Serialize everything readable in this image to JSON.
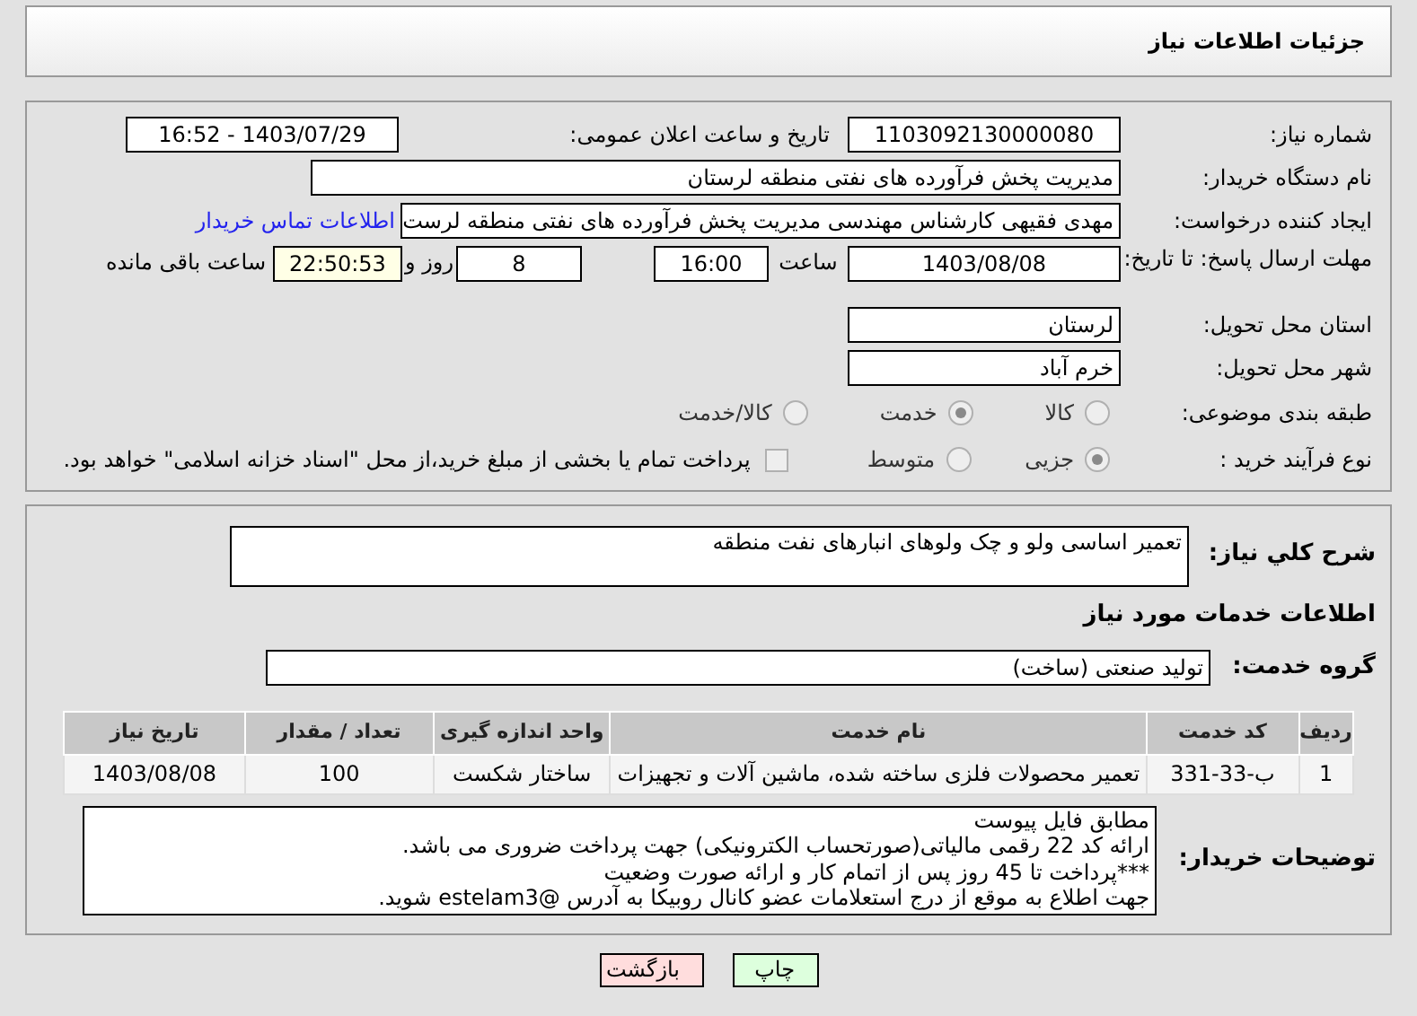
{
  "page_title": "جزئیات اطلاعات نیاز",
  "need_number": {
    "label": "شماره نیاز:",
    "value": "1103092130000080"
  },
  "announce_date": {
    "label": "تاریخ و ساعت اعلان عمومی:",
    "value": "1403/07/29 - 16:52"
  },
  "buyer_org": {
    "label": "نام دستگاه خریدار:",
    "value": "مدیریت پخش فرآورده های نفتی منطقه لرستان"
  },
  "requester": {
    "label": "ایجاد کننده درخواست:",
    "value": "مهدی فقیهی کارشناس مهندسی مدیریت پخش فرآورده های نفتی منطقه لرست",
    "link": "اطلاعات تماس خریدار"
  },
  "deadline": {
    "label": "مهلت ارسال پاسخ: تا تاریخ:",
    "date": "1403/08/08",
    "time_label": "ساعت",
    "time": "16:00",
    "days": "8",
    "days_label": "روز و",
    "remaining": "22:50:53",
    "remaining_label": "ساعت باقی مانده"
  },
  "province": {
    "label": "استان محل تحویل:",
    "value": "لرستان"
  },
  "city": {
    "label": "شهر محل تحویل:",
    "value": "خرم آباد"
  },
  "category": {
    "label": "طبقه بندی موضوعی:",
    "options": [
      {
        "label": "کالا",
        "selected": false
      },
      {
        "label": "خدمت",
        "selected": true
      },
      {
        "label": "کالا/خدمت",
        "selected": false
      }
    ]
  },
  "purchase_type": {
    "label": "نوع فرآیند خرید :",
    "options": [
      {
        "label": "جزیی",
        "selected": true
      },
      {
        "label": "متوسط",
        "selected": false
      }
    ],
    "payment": {
      "label": "پرداخت تمام یا بخشی از مبلغ خرید،از محل \"اسناد خزانه اسلامی\" خواهد بود.",
      "checked": false
    }
  },
  "description": {
    "label": "شرح کلي نياز:",
    "value": "تعمیر اساسی ولو و چک ولوهای انبارهای نفت منطقه"
  },
  "services_heading": "اطلاعات خدمات مورد نیاز",
  "service_group": {
    "label": "گروه خدمت:",
    "value": "تولید صنعتی (ساخت)"
  },
  "table": {
    "columns": [
      "ردیف",
      "کد خدمت",
      "نام خدمت",
      "واحد اندازه گیری",
      "تعداد / مقدار",
      "تاریخ نیاز"
    ],
    "rows": [
      [
        "1",
        "ب-33-331",
        "تعمیر محصولات فلزی ساخته شده، ماشین آلات و تجهیزات",
        "ساختار شکست",
        "100",
        "1403/08/08"
      ]
    ]
  },
  "buyer_notes": {
    "label": "توضیحات خریدار:",
    "lines": [
      "مطابق فایل پیوست",
      "ارائه کد 22 رقمی مالیاتی(صورتحساب الکترونیکی) جهت پرداخت ضروری می باشد.",
      "***پرداخت تا 45 روز پس از اتمام کار و ارائه صورت وضعیت",
      "جهت اطلاع به موقع از درج استعلامات عضو کانال روبیکا به آدرس @estelam3 شوید."
    ]
  },
  "buttons": [
    {
      "label": "چاپ",
      "kind": "print"
    },
    {
      "label": "بازگشت",
      "kind": "back"
    }
  ]
}
